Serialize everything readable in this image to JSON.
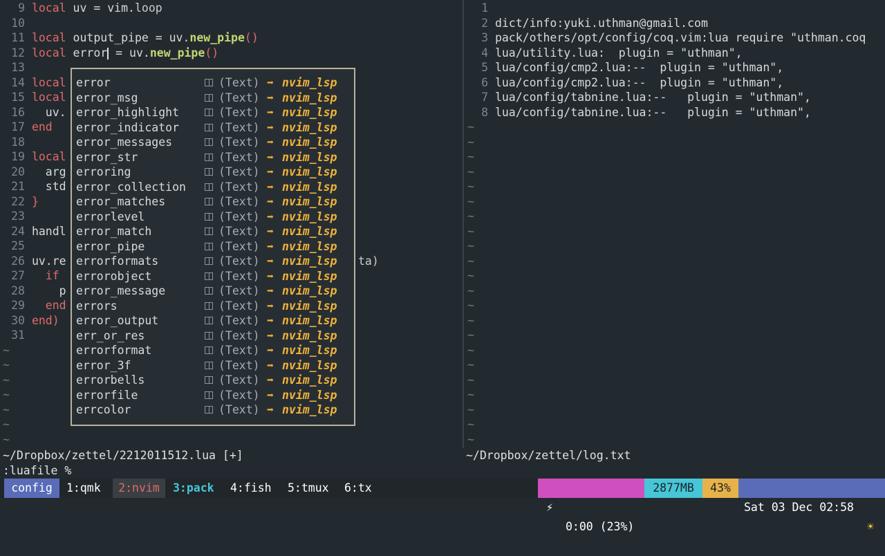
{
  "left_pane": {
    "lines": [
      {
        "n": "9",
        "t": "local uv = vim.loop"
      },
      {
        "n": "10",
        "t": ""
      },
      {
        "n": "11",
        "t": "local output_pipe = uv.new_pipe()"
      },
      {
        "n": "12",
        "t": "local error = uv.new_pipe()"
      },
      {
        "n": "13",
        "t": ""
      },
      {
        "n": "14",
        "t": "local"
      },
      {
        "n": "15",
        "t": "local"
      },
      {
        "n": "16",
        "t": "  uv."
      },
      {
        "n": "17",
        "t": "end"
      },
      {
        "n": "18",
        "t": ""
      },
      {
        "n": "19",
        "t": "local"
      },
      {
        "n": "20",
        "t": "  arg"
      },
      {
        "n": "21",
        "t": "  std"
      },
      {
        "n": "22",
        "t": "}"
      },
      {
        "n": "23",
        "t": ""
      },
      {
        "n": "24",
        "t": "handl"
      },
      {
        "n": "25",
        "t": ""
      },
      {
        "n": "26",
        "t": "uv.re"
      },
      {
        "n": "27",
        "t": "  if"
      },
      {
        "n": "28",
        "t": "    p"
      },
      {
        "n": "29",
        "t": "  end"
      },
      {
        "n": "30",
        "t": "end)"
      },
      {
        "n": "31",
        "t": ""
      }
    ],
    "trailing_fragment": "ta)",
    "tildes": 7,
    "statusline": "~/Dropbox/zettel/2212011512.lua [+]"
  },
  "completion": {
    "items": [
      "error",
      "error_msg",
      "error_highlight",
      "error_indicator",
      "error_messages",
      "error_str",
      "erroring",
      "error_collection",
      "error_matches",
      "errorlevel",
      "error_match",
      "error_pipe",
      "errorformats",
      "errorobject",
      "error_message",
      "errors",
      "error_output",
      "err_or_res",
      "errorformat",
      "error_3f",
      "errorbells",
      "errorfile",
      "errcolor"
    ],
    "kind": "(Text)",
    "arrow": "➡",
    "source": "nvim_lsp"
  },
  "right_pane": {
    "lines": [
      {
        "n": "1",
        "t": ""
      },
      {
        "n": "2",
        "t": "dict/info:yuki.uthman@gmail.com"
      },
      {
        "n": "3",
        "t": "pack/others/opt/config/coq.vim:lua require \"uthman.coq"
      },
      {
        "n": "4",
        "t": "lua/utility.lua:  plugin = \"uthman\","
      },
      {
        "n": "5",
        "t": "lua/config/cmp2.lua:--  plugin = \"uthman\","
      },
      {
        "n": "6",
        "t": "lua/config/cmp2.lua:--  plugin = \"uthman\","
      },
      {
        "n": "7",
        "t": "lua/config/tabnine.lua:--   plugin = \"uthman\","
      },
      {
        "n": "8",
        "t": "lua/config/tabnine.lua:--   plugin = \"uthman\","
      }
    ],
    "tildes": 22,
    "statusline": "~/Dropbox/zettel/log.txt"
  },
  "cmdline": ":luafile %",
  "tmux": {
    "session": "config",
    "windows": [
      "1:qmk",
      "2:nvim",
      "3:pack",
      "4:fish",
      "5:tmux",
      "6:tx"
    ],
    "battery_icon": "⚡",
    "battery": "0:00 (23%)",
    "memory": "2877MB",
    "cpu": "43%",
    "datetime": "Sat 03 Dec 02:58",
    "weather_icon": "☀",
    "colors": {
      "session_bg": "#5a6cb8",
      "active_window": "#e06a6a",
      "prev_window": "#46c6d6",
      "battery_bg": "#d04fc0",
      "memory_bg": "#46c6d6",
      "cpu_bg": "#e7b24a",
      "datetime_bg": "#5a6cb8"
    }
  }
}
